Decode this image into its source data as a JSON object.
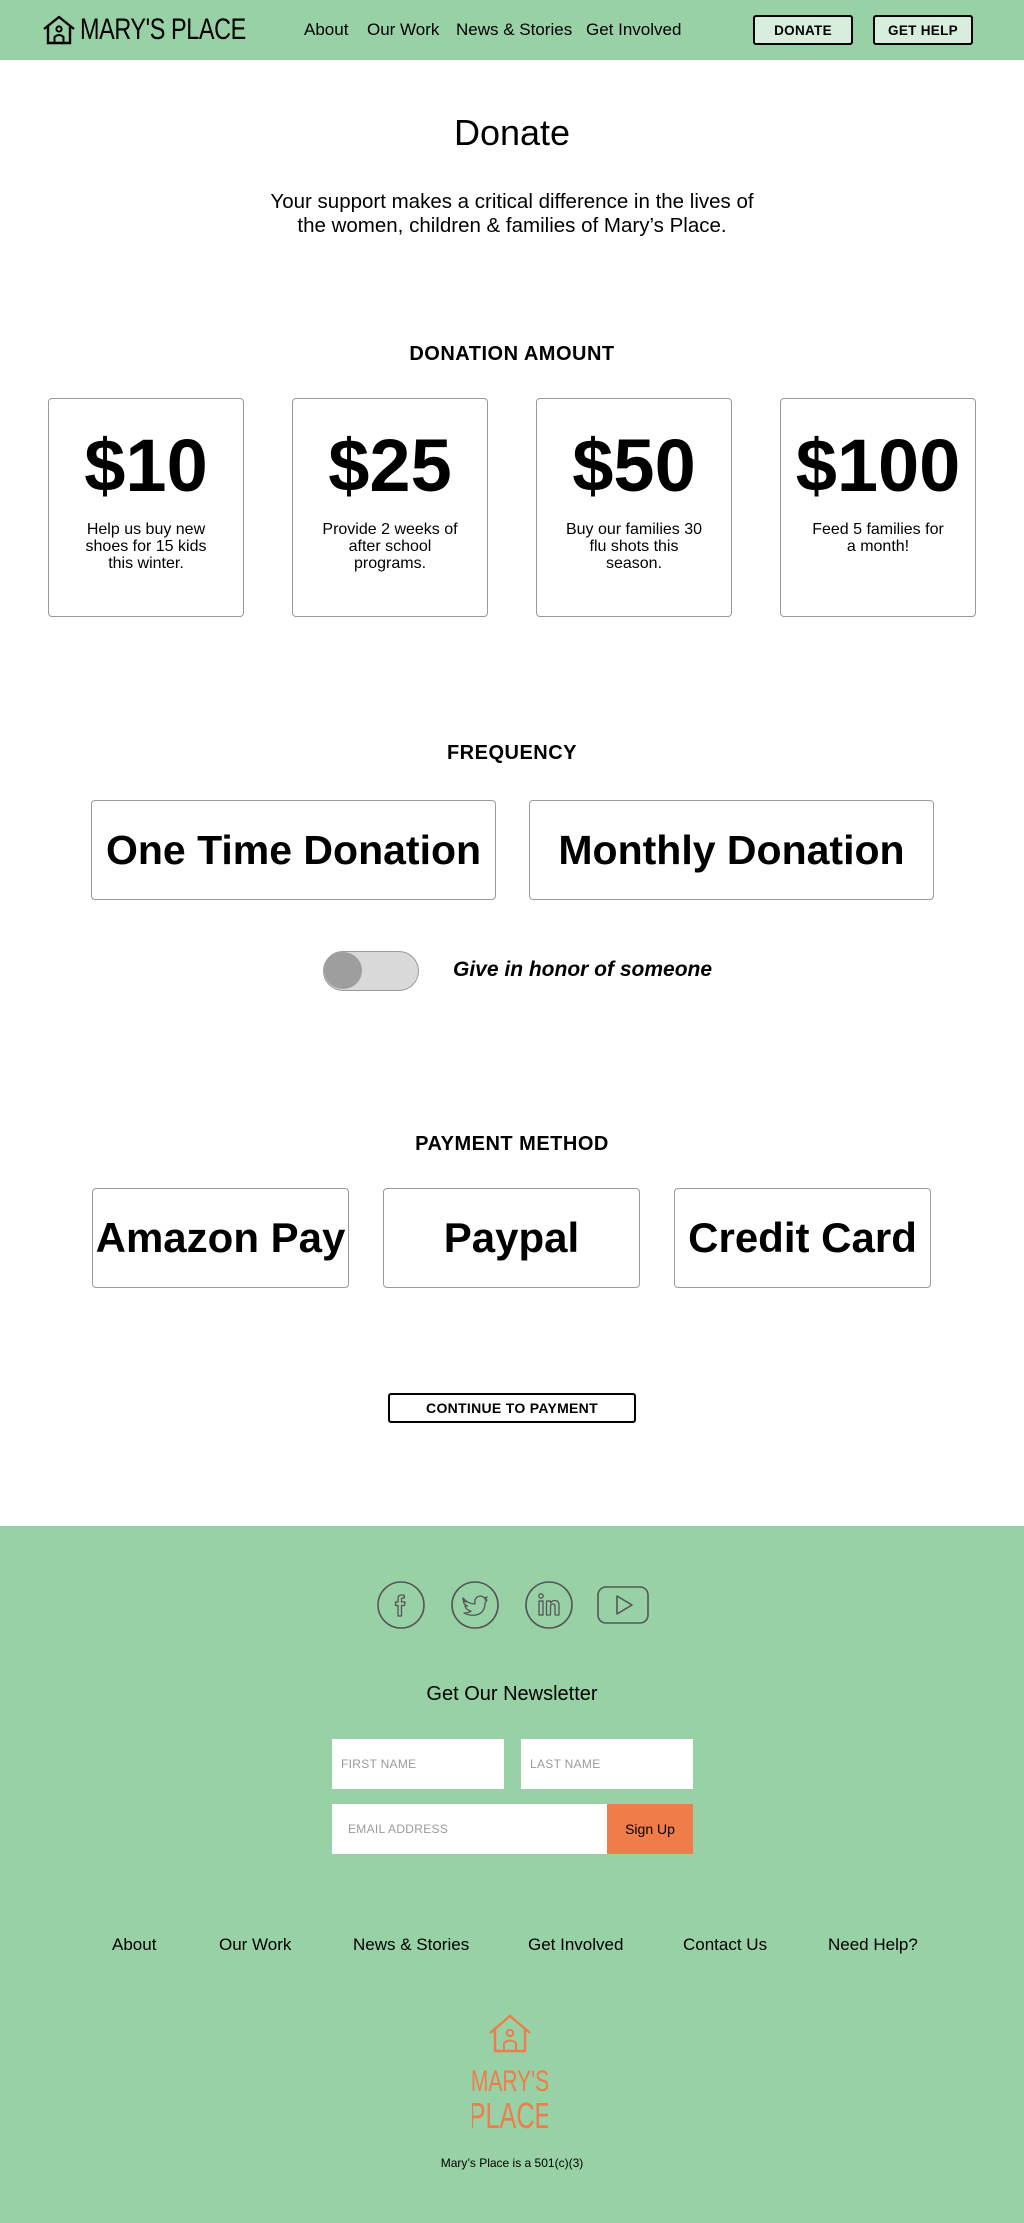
{
  "header": {
    "logo_text": "MARY'S PLACE",
    "nav": [
      "About",
      "Our Work",
      "News & Stories",
      "Get Involved"
    ],
    "donate_label": "DONATE",
    "help_label": "GET HELP"
  },
  "hero": {
    "title": "Donate",
    "subtitle": "Your support makes a critical difference in the lives of the women, children & families of Mary’s Place."
  },
  "amount": {
    "heading": "DONATION AMOUNT",
    "options": [
      {
        "value": "$10",
        "desc": "Help us buy new shoes for 15 kids this winter."
      },
      {
        "value": "$25",
        "desc": "Provide 2 weeks of after school programs."
      },
      {
        "value": "$50",
        "desc": "Buy our families 30 flu shots this season."
      },
      {
        "value": "$100",
        "desc": "Feed 5 families for a month!"
      }
    ]
  },
  "frequency": {
    "heading": "FREQUENCY",
    "one_time": "One Time Donation",
    "monthly": "Monthly Donation",
    "honor_label": "Give in honor of someone"
  },
  "payment": {
    "heading": "PAYMENT METHOD",
    "methods": [
      "Amazon Pay",
      "Paypal",
      "Credit Card"
    ],
    "continue_label": "CONTINUE TO PAYMENT"
  },
  "footer": {
    "social_icons": [
      "facebook-icon",
      "twitter-icon",
      "linkedin-icon",
      "youtube-icon"
    ],
    "newsletter_title": "Get Our Newsletter",
    "first_name_placeholder": "FIRST NAME",
    "last_name_placeholder": "LAST NAME",
    "email_placeholder": "EMAIL ADDRESS",
    "signup_label": "Sign Up",
    "nav": [
      "About",
      "Our Work",
      "News & Stories",
      "Get Involved",
      "Contact Us",
      "Need Help?"
    ],
    "logo_line1": "MARY'S",
    "logo_line2": "PLACE",
    "note": "Mary’s Place is a 501(c)(3)"
  },
  "colors": {
    "brand_green": "#99d1a6",
    "accent_orange": "#f07c4a",
    "button_tint": "#d6eedb"
  }
}
